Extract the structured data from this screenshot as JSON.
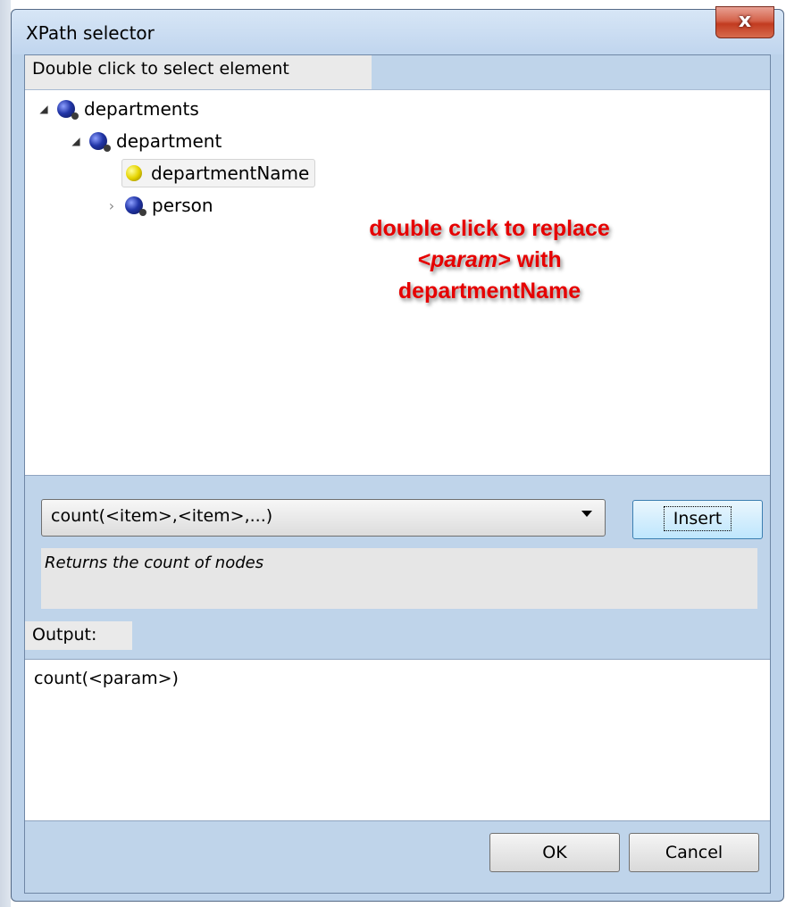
{
  "window": {
    "title": "XPath selector",
    "close_label": "x"
  },
  "tree_caption": "Double click to select element",
  "tree": [
    {
      "label": "departments",
      "icon": "element-icon",
      "expanded": true
    },
    {
      "label": "department",
      "icon": "element-icon",
      "expanded": true
    },
    {
      "label": "departmentName",
      "icon": "attribute-icon",
      "selected": true
    },
    {
      "label": "person",
      "icon": "element-icon",
      "expanded": false
    }
  ],
  "annotation": {
    "line1": "double click to replace",
    "param": "<param>",
    "with": " with",
    "line3": "departmentName",
    "color": "#e60000"
  },
  "function_select": {
    "value": "count(<item>,<item>,...)"
  },
  "insert_label": "Insert",
  "description": "Returns the count of nodes",
  "output_caption": "Output:",
  "output_text": "count(<param>)",
  "ok_label": "OK",
  "cancel_label": "Cancel"
}
